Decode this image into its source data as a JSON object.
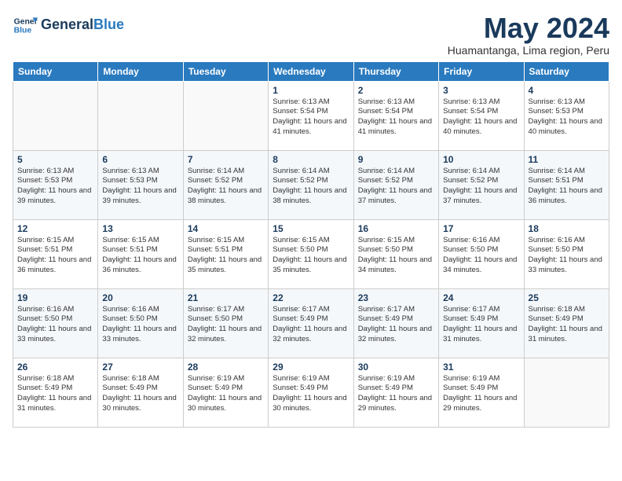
{
  "header": {
    "logo_line1": "General",
    "logo_line2": "Blue",
    "month": "May 2024",
    "location": "Huamantanga, Lima region, Peru"
  },
  "weekdays": [
    "Sunday",
    "Monday",
    "Tuesday",
    "Wednesday",
    "Thursday",
    "Friday",
    "Saturday"
  ],
  "weeks": [
    [
      {
        "day": "",
        "sunrise": "",
        "sunset": "",
        "daylight": ""
      },
      {
        "day": "",
        "sunrise": "",
        "sunset": "",
        "daylight": ""
      },
      {
        "day": "",
        "sunrise": "",
        "sunset": "",
        "daylight": ""
      },
      {
        "day": "1",
        "sunrise": "Sunrise: 6:13 AM",
        "sunset": "Sunset: 5:54 PM",
        "daylight": "Daylight: 11 hours and 41 minutes."
      },
      {
        "day": "2",
        "sunrise": "Sunrise: 6:13 AM",
        "sunset": "Sunset: 5:54 PM",
        "daylight": "Daylight: 11 hours and 41 minutes."
      },
      {
        "day": "3",
        "sunrise": "Sunrise: 6:13 AM",
        "sunset": "Sunset: 5:54 PM",
        "daylight": "Daylight: 11 hours and 40 minutes."
      },
      {
        "day": "4",
        "sunrise": "Sunrise: 6:13 AM",
        "sunset": "Sunset: 5:53 PM",
        "daylight": "Daylight: 11 hours and 40 minutes."
      }
    ],
    [
      {
        "day": "5",
        "sunrise": "Sunrise: 6:13 AM",
        "sunset": "Sunset: 5:53 PM",
        "daylight": "Daylight: 11 hours and 39 minutes."
      },
      {
        "day": "6",
        "sunrise": "Sunrise: 6:13 AM",
        "sunset": "Sunset: 5:53 PM",
        "daylight": "Daylight: 11 hours and 39 minutes."
      },
      {
        "day": "7",
        "sunrise": "Sunrise: 6:14 AM",
        "sunset": "Sunset: 5:52 PM",
        "daylight": "Daylight: 11 hours and 38 minutes."
      },
      {
        "day": "8",
        "sunrise": "Sunrise: 6:14 AM",
        "sunset": "Sunset: 5:52 PM",
        "daylight": "Daylight: 11 hours and 38 minutes."
      },
      {
        "day": "9",
        "sunrise": "Sunrise: 6:14 AM",
        "sunset": "Sunset: 5:52 PM",
        "daylight": "Daylight: 11 hours and 37 minutes."
      },
      {
        "day": "10",
        "sunrise": "Sunrise: 6:14 AM",
        "sunset": "Sunset: 5:52 PM",
        "daylight": "Daylight: 11 hours and 37 minutes."
      },
      {
        "day": "11",
        "sunrise": "Sunrise: 6:14 AM",
        "sunset": "Sunset: 5:51 PM",
        "daylight": "Daylight: 11 hours and 36 minutes."
      }
    ],
    [
      {
        "day": "12",
        "sunrise": "Sunrise: 6:15 AM",
        "sunset": "Sunset: 5:51 PM",
        "daylight": "Daylight: 11 hours and 36 minutes."
      },
      {
        "day": "13",
        "sunrise": "Sunrise: 6:15 AM",
        "sunset": "Sunset: 5:51 PM",
        "daylight": "Daylight: 11 hours and 36 minutes."
      },
      {
        "day": "14",
        "sunrise": "Sunrise: 6:15 AM",
        "sunset": "Sunset: 5:51 PM",
        "daylight": "Daylight: 11 hours and 35 minutes."
      },
      {
        "day": "15",
        "sunrise": "Sunrise: 6:15 AM",
        "sunset": "Sunset: 5:50 PM",
        "daylight": "Daylight: 11 hours and 35 minutes."
      },
      {
        "day": "16",
        "sunrise": "Sunrise: 6:15 AM",
        "sunset": "Sunset: 5:50 PM",
        "daylight": "Daylight: 11 hours and 34 minutes."
      },
      {
        "day": "17",
        "sunrise": "Sunrise: 6:16 AM",
        "sunset": "Sunset: 5:50 PM",
        "daylight": "Daylight: 11 hours and 34 minutes."
      },
      {
        "day": "18",
        "sunrise": "Sunrise: 6:16 AM",
        "sunset": "Sunset: 5:50 PM",
        "daylight": "Daylight: 11 hours and 33 minutes."
      }
    ],
    [
      {
        "day": "19",
        "sunrise": "Sunrise: 6:16 AM",
        "sunset": "Sunset: 5:50 PM",
        "daylight": "Daylight: 11 hours and 33 minutes."
      },
      {
        "day": "20",
        "sunrise": "Sunrise: 6:16 AM",
        "sunset": "Sunset: 5:50 PM",
        "daylight": "Daylight: 11 hours and 33 minutes."
      },
      {
        "day": "21",
        "sunrise": "Sunrise: 6:17 AM",
        "sunset": "Sunset: 5:50 PM",
        "daylight": "Daylight: 11 hours and 32 minutes."
      },
      {
        "day": "22",
        "sunrise": "Sunrise: 6:17 AM",
        "sunset": "Sunset: 5:49 PM",
        "daylight": "Daylight: 11 hours and 32 minutes."
      },
      {
        "day": "23",
        "sunrise": "Sunrise: 6:17 AM",
        "sunset": "Sunset: 5:49 PM",
        "daylight": "Daylight: 11 hours and 32 minutes."
      },
      {
        "day": "24",
        "sunrise": "Sunrise: 6:17 AM",
        "sunset": "Sunset: 5:49 PM",
        "daylight": "Daylight: 11 hours and 31 minutes."
      },
      {
        "day": "25",
        "sunrise": "Sunrise: 6:18 AM",
        "sunset": "Sunset: 5:49 PM",
        "daylight": "Daylight: 11 hours and 31 minutes."
      }
    ],
    [
      {
        "day": "26",
        "sunrise": "Sunrise: 6:18 AM",
        "sunset": "Sunset: 5:49 PM",
        "daylight": "Daylight: 11 hours and 31 minutes."
      },
      {
        "day": "27",
        "sunrise": "Sunrise: 6:18 AM",
        "sunset": "Sunset: 5:49 PM",
        "daylight": "Daylight: 11 hours and 30 minutes."
      },
      {
        "day": "28",
        "sunrise": "Sunrise: 6:19 AM",
        "sunset": "Sunset: 5:49 PM",
        "daylight": "Daylight: 11 hours and 30 minutes."
      },
      {
        "day": "29",
        "sunrise": "Sunrise: 6:19 AM",
        "sunset": "Sunset: 5:49 PM",
        "daylight": "Daylight: 11 hours and 30 minutes."
      },
      {
        "day": "30",
        "sunrise": "Sunrise: 6:19 AM",
        "sunset": "Sunset: 5:49 PM",
        "daylight": "Daylight: 11 hours and 29 minutes."
      },
      {
        "day": "31",
        "sunrise": "Sunrise: 6:19 AM",
        "sunset": "Sunset: 5:49 PM",
        "daylight": "Daylight: 11 hours and 29 minutes."
      },
      {
        "day": "",
        "sunrise": "",
        "sunset": "",
        "daylight": ""
      }
    ]
  ]
}
